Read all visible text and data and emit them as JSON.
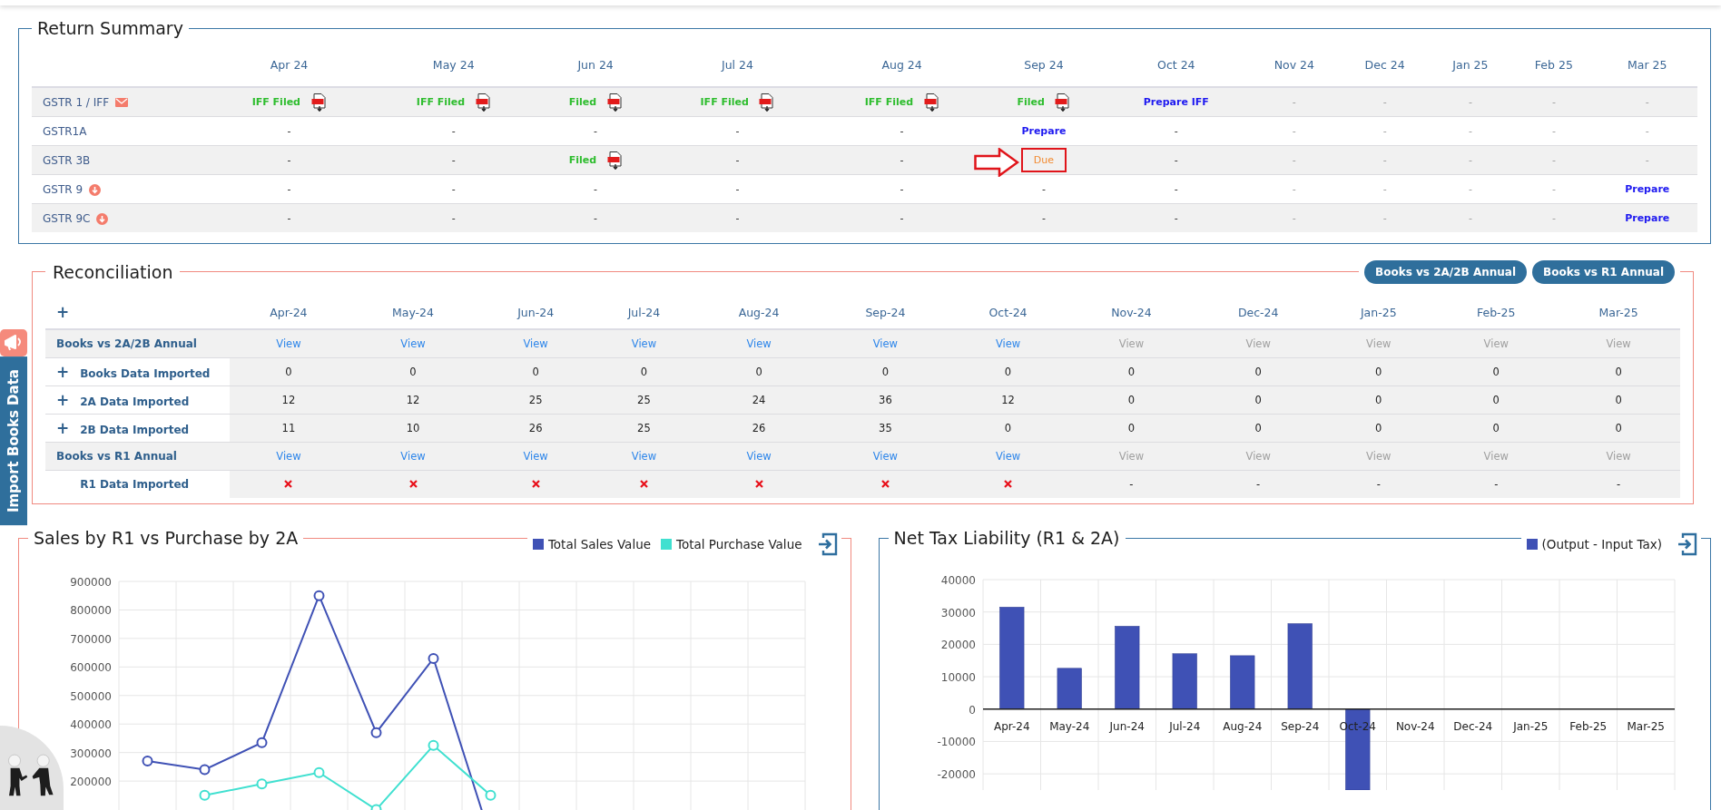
{
  "return_summary": {
    "title": "Return Summary",
    "months": [
      "Apr 24",
      "May 24",
      "Jun 24",
      "Jul 24",
      "Aug 24",
      "Sep 24",
      "Oct 24",
      "Nov 24",
      "Dec 24",
      "Jan 25",
      "Feb 25",
      "Mar 25"
    ],
    "rows": [
      {
        "label": "GSTR 1 / IFF",
        "kind": "envelope",
        "cells": [
          {
            "text": "IFF Filed",
            "kind": "filed"
          },
          {
            "text": "IFF Filed",
            "kind": "filed"
          },
          {
            "text": "Filed",
            "kind": "filed"
          },
          {
            "text": "IFF Filed",
            "kind": "filed"
          },
          {
            "text": "IFF Filed",
            "kind": "filed"
          },
          {
            "text": "Filed",
            "kind": "filed"
          },
          {
            "text": "Prepare IFF",
            "kind": "prepare"
          },
          {
            "text": "-",
            "kind": "muted"
          },
          {
            "text": "-",
            "kind": "muted"
          },
          {
            "text": "-",
            "kind": "muted"
          },
          {
            "text": "-",
            "kind": "muted"
          },
          {
            "text": "-",
            "kind": "muted"
          }
        ]
      },
      {
        "label": "GSTR1A",
        "kind": "plain",
        "cells": [
          {
            "text": "-",
            "kind": "dash"
          },
          {
            "text": "-",
            "kind": "dash"
          },
          {
            "text": "-",
            "kind": "dash"
          },
          {
            "text": "-",
            "kind": "dash"
          },
          {
            "text": "-",
            "kind": "dash"
          },
          {
            "text": "Prepare",
            "kind": "prepare"
          },
          {
            "text": "-",
            "kind": "dash"
          },
          {
            "text": "-",
            "kind": "muted"
          },
          {
            "text": "-",
            "kind": "muted"
          },
          {
            "text": "-",
            "kind": "muted"
          },
          {
            "text": "-",
            "kind": "muted"
          },
          {
            "text": "-",
            "kind": "muted"
          }
        ]
      },
      {
        "label": "GSTR 3B",
        "kind": "plain",
        "cells": [
          {
            "text": "-",
            "kind": "dash"
          },
          {
            "text": "-",
            "kind": "dash"
          },
          {
            "text": "Filed",
            "kind": "filed"
          },
          {
            "text": "-",
            "kind": "dash"
          },
          {
            "text": "-",
            "kind": "dash"
          },
          {
            "text": "Due",
            "kind": "due",
            "flagged": true
          },
          {
            "text": "-",
            "kind": "dash"
          },
          {
            "text": "-",
            "kind": "muted"
          },
          {
            "text": "-",
            "kind": "muted"
          },
          {
            "text": "-",
            "kind": "muted"
          },
          {
            "text": "-",
            "kind": "muted"
          },
          {
            "text": "-",
            "kind": "muted"
          }
        ]
      },
      {
        "label": "GSTR 9",
        "kind": "download",
        "cells": [
          {
            "text": "-",
            "kind": "dash"
          },
          {
            "text": "-",
            "kind": "dash"
          },
          {
            "text": "-",
            "kind": "dash"
          },
          {
            "text": "-",
            "kind": "dash"
          },
          {
            "text": "-",
            "kind": "dash"
          },
          {
            "text": "-",
            "kind": "dash"
          },
          {
            "text": "-",
            "kind": "dash"
          },
          {
            "text": "-",
            "kind": "muted"
          },
          {
            "text": "-",
            "kind": "muted"
          },
          {
            "text": "-",
            "kind": "muted"
          },
          {
            "text": "-",
            "kind": "muted"
          },
          {
            "text": "Prepare",
            "kind": "prepare"
          }
        ]
      },
      {
        "label": "GSTR 9C",
        "kind": "download",
        "cells": [
          {
            "text": "-",
            "kind": "dash"
          },
          {
            "text": "-",
            "kind": "dash"
          },
          {
            "text": "-",
            "kind": "dash"
          },
          {
            "text": "-",
            "kind": "dash"
          },
          {
            "text": "-",
            "kind": "dash"
          },
          {
            "text": "-",
            "kind": "dash"
          },
          {
            "text": "-",
            "kind": "dash"
          },
          {
            "text": "-",
            "kind": "muted"
          },
          {
            "text": "-",
            "kind": "muted"
          },
          {
            "text": "-",
            "kind": "muted"
          },
          {
            "text": "-",
            "kind": "muted"
          },
          {
            "text": "Prepare",
            "kind": "prepare"
          }
        ]
      }
    ]
  },
  "reconciliation": {
    "title": "Reconciliation",
    "buttons": [
      "Books vs 2A/2B Annual",
      "Books vs R1 Annual"
    ],
    "header_toggle": "+",
    "months": [
      "Apr-24",
      "May-24",
      "Jun-24",
      "Jul-24",
      "Aug-24",
      "Sep-24",
      "Oct-24",
      "Nov-24",
      "Dec-24",
      "Jan-25",
      "Feb-25",
      "Mar-25"
    ],
    "rows": [
      {
        "label": "Books vs 2A/2B Annual",
        "kind": "summary",
        "cells": [
          {
            "text": "View",
            "kind": "link",
            "disabled": false
          },
          {
            "text": "View",
            "kind": "link",
            "disabled": false
          },
          {
            "text": "View",
            "kind": "link",
            "disabled": false
          },
          {
            "text": "View",
            "kind": "link",
            "disabled": false
          },
          {
            "text": "View",
            "kind": "link",
            "disabled": false
          },
          {
            "text": "View",
            "kind": "link",
            "disabled": false
          },
          {
            "text": "View",
            "kind": "link",
            "disabled": false
          },
          {
            "text": "View",
            "kind": "link",
            "disabled": true
          },
          {
            "text": "View",
            "kind": "link",
            "disabled": true
          },
          {
            "text": "View",
            "kind": "link",
            "disabled": true
          },
          {
            "text": "View",
            "kind": "link",
            "disabled": true
          },
          {
            "text": "View",
            "kind": "link",
            "disabled": true
          }
        ]
      },
      {
        "toggle": "+",
        "label": "Books Data Imported",
        "kind": "data",
        "cells": [
          {
            "text": "0",
            "kind": "value"
          },
          {
            "text": "0",
            "kind": "value"
          },
          {
            "text": "0",
            "kind": "value"
          },
          {
            "text": "0",
            "kind": "value"
          },
          {
            "text": "0",
            "kind": "value"
          },
          {
            "text": "0",
            "kind": "value"
          },
          {
            "text": "0",
            "kind": "value"
          },
          {
            "text": "0",
            "kind": "value"
          },
          {
            "text": "0",
            "kind": "value"
          },
          {
            "text": "0",
            "kind": "value"
          },
          {
            "text": "0",
            "kind": "value"
          },
          {
            "text": "0",
            "kind": "value"
          }
        ]
      },
      {
        "toggle": "+",
        "label": "2A Data Imported",
        "kind": "data",
        "cells": [
          {
            "text": "12",
            "kind": "value"
          },
          {
            "text": "12",
            "kind": "value"
          },
          {
            "text": "25",
            "kind": "value"
          },
          {
            "text": "25",
            "kind": "value"
          },
          {
            "text": "24",
            "kind": "value"
          },
          {
            "text": "36",
            "kind": "value"
          },
          {
            "text": "12",
            "kind": "value"
          },
          {
            "text": "0",
            "kind": "value"
          },
          {
            "text": "0",
            "kind": "value"
          },
          {
            "text": "0",
            "kind": "value"
          },
          {
            "text": "0",
            "kind": "value"
          },
          {
            "text": "0",
            "kind": "value"
          }
        ]
      },
      {
        "toggle": "+",
        "label": "2B Data Imported",
        "kind": "data",
        "cells": [
          {
            "text": "11",
            "kind": "value"
          },
          {
            "text": "10",
            "kind": "value"
          },
          {
            "text": "26",
            "kind": "value"
          },
          {
            "text": "25",
            "kind": "value"
          },
          {
            "text": "26",
            "kind": "value"
          },
          {
            "text": "35",
            "kind": "value"
          },
          {
            "text": "0",
            "kind": "value"
          },
          {
            "text": "0",
            "kind": "value"
          },
          {
            "text": "0",
            "kind": "value"
          },
          {
            "text": "0",
            "kind": "value"
          },
          {
            "text": "0",
            "kind": "value"
          },
          {
            "text": "0",
            "kind": "value"
          }
        ]
      },
      {
        "label": "Books vs R1 Annual",
        "kind": "summary",
        "cells": [
          {
            "text": "View",
            "kind": "link",
            "disabled": false
          },
          {
            "text": "View",
            "kind": "link",
            "disabled": false
          },
          {
            "text": "View",
            "kind": "link",
            "disabled": false
          },
          {
            "text": "View",
            "kind": "link",
            "disabled": false
          },
          {
            "text": "View",
            "kind": "link",
            "disabled": false
          },
          {
            "text": "View",
            "kind": "link",
            "disabled": false
          },
          {
            "text": "View",
            "kind": "link",
            "disabled": false
          },
          {
            "text": "View",
            "kind": "link",
            "disabled": true
          },
          {
            "text": "View",
            "kind": "link",
            "disabled": true
          },
          {
            "text": "View",
            "kind": "link",
            "disabled": true
          },
          {
            "text": "View",
            "kind": "link",
            "disabled": true
          },
          {
            "text": "View",
            "kind": "link",
            "disabled": true
          }
        ]
      },
      {
        "label": "R1 Data Imported",
        "kind": "data",
        "cells": [
          {
            "kind": "missing"
          },
          {
            "kind": "missing"
          },
          {
            "kind": "missing"
          },
          {
            "kind": "missing"
          },
          {
            "kind": "missing"
          },
          {
            "kind": "missing"
          },
          {
            "kind": "missing"
          },
          {
            "text": "-",
            "kind": "value"
          },
          {
            "text": "-",
            "kind": "value"
          },
          {
            "text": "-",
            "kind": "value"
          },
          {
            "text": "-",
            "kind": "value"
          },
          {
            "text": "-",
            "kind": "value"
          }
        ]
      }
    ]
  },
  "side_tab": {
    "label": "Import Books Data"
  },
  "sales_chart": {
    "chart_data": {
      "type": "line",
      "title": "Sales by R1 vs Purchase by 2A",
      "grid": true,
      "ylim": [
        0,
        900000
      ],
      "yticks": [
        200000,
        300000,
        400000,
        500000,
        600000,
        700000,
        800000,
        900000
      ],
      "series": [
        {
          "name": "Total Sales Value",
          "color": "#3f51b5",
          "marker": "circle",
          "values": [
            270000,
            240000,
            335000,
            850000,
            370000,
            630000,
            0,
            null,
            null,
            null,
            null,
            null
          ]
        },
        {
          "name": "Total Purchase Value",
          "color": "#40e0d0",
          "marker": "circle",
          "values": [
            null,
            150000,
            190000,
            230000,
            100000,
            325000,
            150000,
            null,
            null,
            null,
            null,
            null
          ]
        }
      ]
    }
  },
  "tax_chart": {
    "chart_data": {
      "type": "bar",
      "title": "Net Tax Liability (R1 & 2A)",
      "categories": [
        "Apr-24",
        "May-24",
        "Jun-24",
        "Jul-24",
        "Aug-24",
        "Sep-24",
        "Oct-24",
        "Nov-24",
        "Dec-24",
        "Jan-25",
        "Feb-25",
        "Mar-25"
      ],
      "grid": true,
      "ylim": [
        -25000,
        40000
      ],
      "yticks": [
        -20000,
        -10000,
        0,
        10000,
        20000,
        30000,
        40000
      ],
      "series": [
        {
          "name": "(Output - Input Tax)",
          "color": "#3f51b5",
          "values": [
            31500,
            12600,
            25600,
            17100,
            16500,
            26400,
            -25000,
            0,
            0,
            0,
            0,
            0
          ]
        }
      ]
    }
  }
}
